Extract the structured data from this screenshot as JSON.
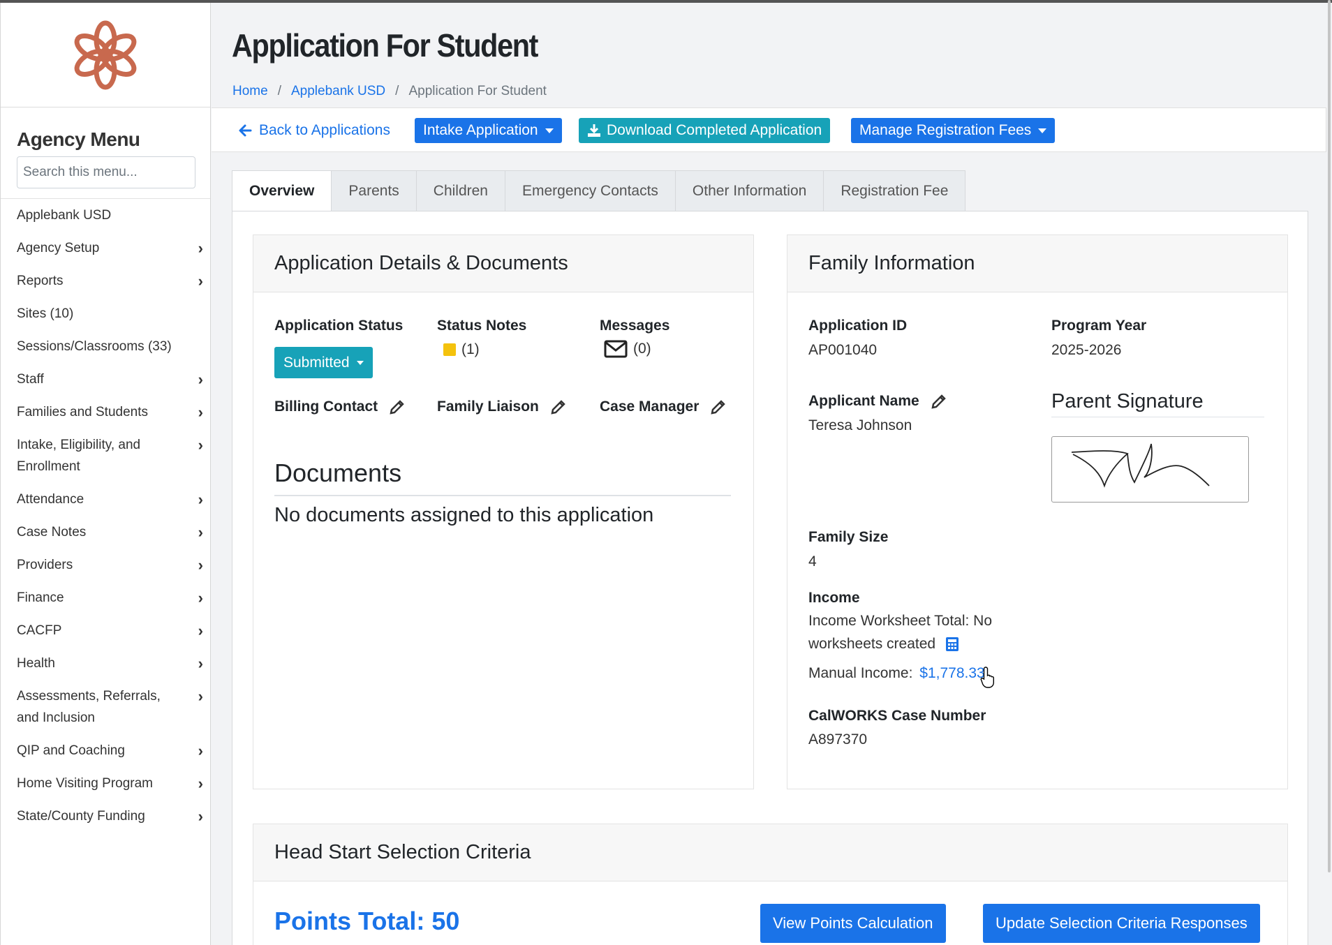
{
  "app": {
    "page_title": "Application For Student",
    "brand_color": "#1a73e8",
    "teal_color": "#17a2b8",
    "logo_color": "#c8694e"
  },
  "breadcrumb": [
    "Home",
    "Applebank USD",
    "Application For Student"
  ],
  "sidebar": {
    "title": "Agency Menu",
    "search_placeholder": "Search this menu...",
    "items": [
      {
        "label": "Applebank USD",
        "has_children": false
      },
      {
        "label": "Agency Setup",
        "has_children": true
      },
      {
        "label": "Reports",
        "has_children": true
      },
      {
        "label": "Sites (10)",
        "has_children": false
      },
      {
        "label": "Sessions/Classrooms (33)",
        "has_children": false
      },
      {
        "label": "Staff",
        "has_children": true
      },
      {
        "label": "Families and Students",
        "has_children": true
      },
      {
        "label": "Intake, Eligibility, and Enrollment",
        "has_children": true
      },
      {
        "label": "Attendance",
        "has_children": true
      },
      {
        "label": "Case Notes",
        "has_children": true
      },
      {
        "label": "Providers",
        "has_children": true
      },
      {
        "label": "Finance",
        "has_children": true
      },
      {
        "label": "CACFP",
        "has_children": true
      },
      {
        "label": "Health",
        "has_children": true
      },
      {
        "label": "Assessments, Referrals, and Inclusion",
        "has_children": true
      },
      {
        "label": "QIP and Coaching",
        "has_children": true
      },
      {
        "label": "Home Visiting Program",
        "has_children": true
      },
      {
        "label": "State/County Funding",
        "has_children": true
      }
    ]
  },
  "toolbar": {
    "back_label": "Back to Applications",
    "intake_label": "Intake Application",
    "download_label": "Download Completed Application",
    "fees_label": "Manage Registration Fees"
  },
  "tabs": [
    "Overview",
    "Parents",
    "Children",
    "Emergency Contacts",
    "Other Information",
    "Registration Fee"
  ],
  "details": {
    "heading": "Application Details & Documents",
    "status_label": "Application Status",
    "status_value": "Submitted",
    "notes_label": "Status Notes",
    "notes_count": "(1)",
    "messages_label": "Messages",
    "messages_count": "(0)",
    "billing_label": "Billing Contact",
    "liaison_label": "Family Liaison",
    "case_manager_label": "Case Manager",
    "documents_title": "Documents",
    "documents_empty": "No documents assigned to this application"
  },
  "family": {
    "heading": "Family Information",
    "app_id_label": "Application ID",
    "app_id": "AP001040",
    "program_year_label": "Program Year",
    "program_year": "2025-2026",
    "applicant_label": "Applicant Name",
    "applicant": "Teresa Johnson",
    "signature_label": "Parent Signature",
    "family_size_label": "Family Size",
    "family_size": "4",
    "income_label": "Income",
    "income_worksheet_line1": "Income Worksheet Total: No",
    "income_worksheet_line2": "worksheets created",
    "manual_income_label": "Manual Income:",
    "manual_income_value": "$1,778.33",
    "calworks_label": "CalWORKS Case Number",
    "calworks": "A897370"
  },
  "selection": {
    "heading": "Head Start Selection Criteria",
    "points_total": "Points Total: 50",
    "view_points": "View Points Calculation",
    "update_responses": "Update Selection Criteria Responses"
  }
}
